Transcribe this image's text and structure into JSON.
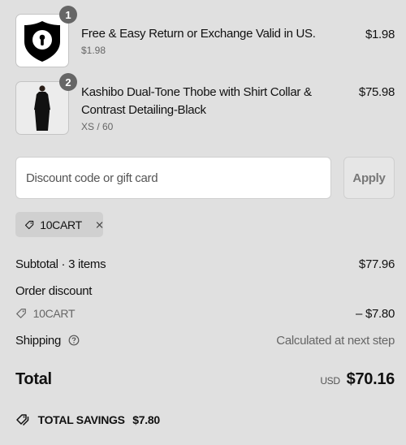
{
  "items": [
    {
      "qty": "1",
      "title": "Free & Easy Return or Exchange Valid in US.",
      "sub": "$1.98",
      "price": "$1.98"
    },
    {
      "qty": "2",
      "title": "Kashibo Dual-Tone Thobe with Shirt Collar & Contrast Detailing-Black",
      "sub": "XS / 60",
      "price": "$75.98"
    }
  ],
  "discount": {
    "placeholder": "Discount code or gift card",
    "apply_label": "Apply",
    "applied_code": "10CART"
  },
  "summary": {
    "subtotal_label": "Subtotal · 3 items",
    "subtotal_value": "$77.96",
    "order_discount_label": "Order discount",
    "discount_code": "10CART",
    "discount_value": "– $7.80",
    "shipping_label": "Shipping",
    "shipping_value": "Calculated at next step",
    "total_label": "Total",
    "currency": "USD",
    "total_value": "$70.16",
    "savings_label": "TOTAL SAVINGS",
    "savings_value": "$7.80"
  },
  "icons": {
    "shield": "shield-keyhole-icon",
    "tag": "tag-icon",
    "remove": "close-icon",
    "help": "question-circle-icon",
    "savings": "tags-icon"
  },
  "colors": {
    "background": "#e0e0e0",
    "badge": "#666666"
  }
}
